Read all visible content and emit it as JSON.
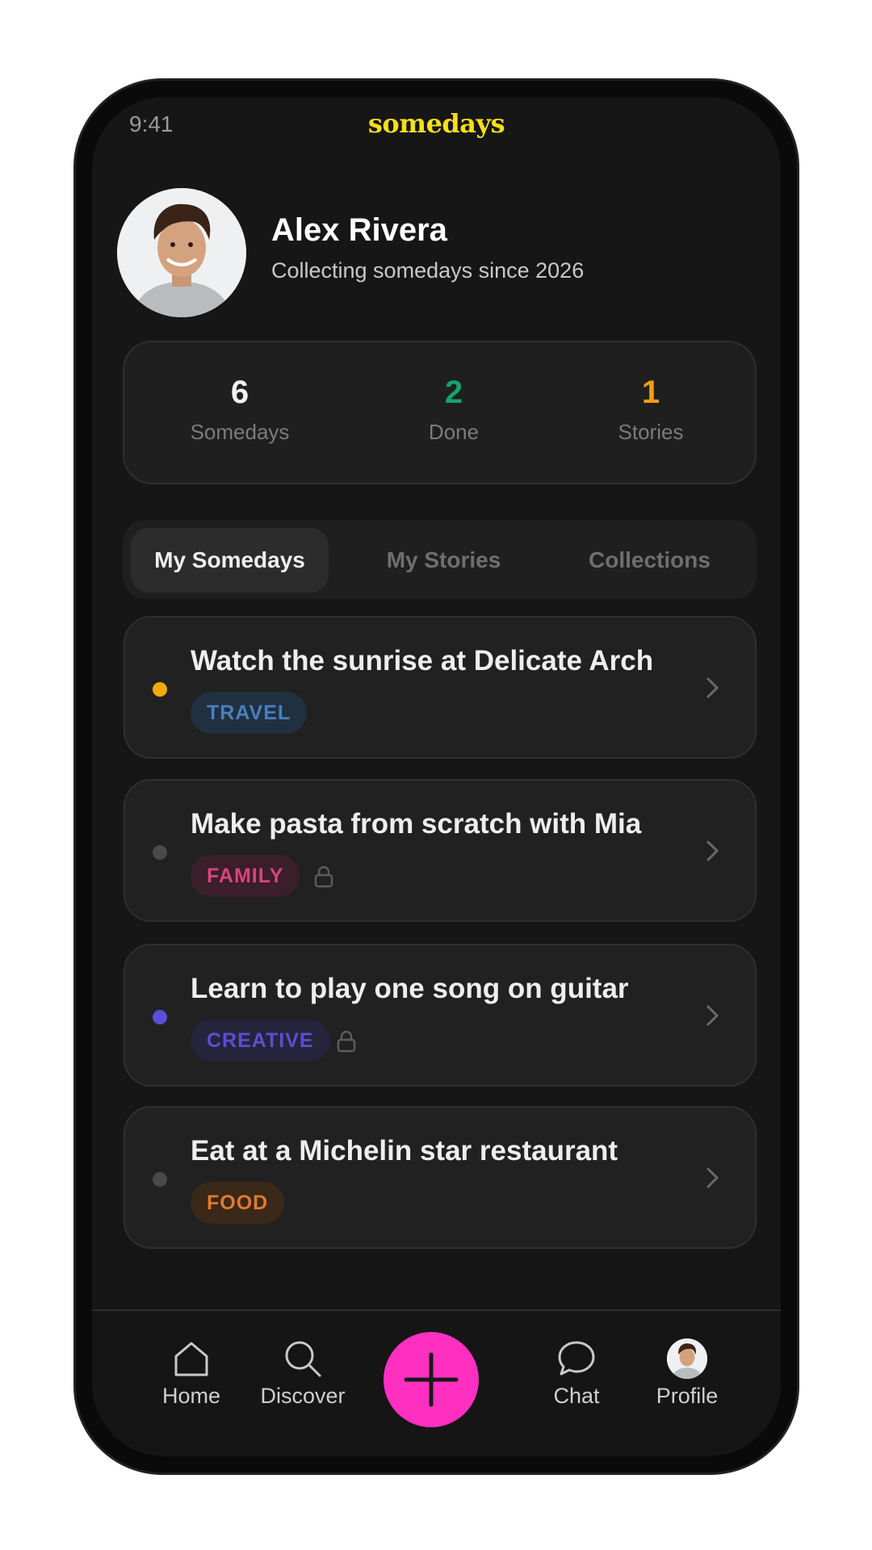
{
  "status": {
    "time": "9:41"
  },
  "app": {
    "brand": "somedays"
  },
  "profile": {
    "name": "Alex Rivera",
    "subtitle": "Collecting somedays since 2026"
  },
  "stats": [
    {
      "value": "6",
      "label": "Somedays",
      "color": "#f2f2f2"
    },
    {
      "value": "2",
      "label": "Done",
      "color": "#16a36b"
    },
    {
      "value": "1",
      "label": "Stories",
      "color": "#f29d12"
    }
  ],
  "tabs": [
    {
      "label": "My Somedays",
      "active": true
    },
    {
      "label": "My Stories",
      "active": false
    },
    {
      "label": "Collections",
      "active": false
    }
  ],
  "somedays": [
    {
      "title": "Watch the sunrise at Delicate Arch",
      "tag": "TRAVEL",
      "dot_color": "#f5a70f",
      "tag_color": "#4a7fc0",
      "tag_bg": "#203040",
      "locked": false
    },
    {
      "title": "Make pasta from scratch with Mia",
      "tag": "FAMILY",
      "dot_color": "#4a4a4a",
      "tag_color": "#d6457b",
      "tag_bg": "#3a1e2a",
      "locked": true
    },
    {
      "title": "Learn to play one song on guitar",
      "tag": "CREATIVE",
      "dot_color": "#5a4fd6",
      "tag_color": "#5b4fd1",
      "tag_bg": "#26243c",
      "locked": true
    },
    {
      "title": "Eat at a Michelin star restaurant",
      "tag": "FOOD",
      "dot_color": "#4a4a4a",
      "tag_color": "#e07a2e",
      "tag_bg": "#3a2818",
      "locked": false
    }
  ],
  "nav": {
    "home": "Home",
    "discover": "Discover",
    "chat": "Chat",
    "profile": "Profile",
    "add_color": "#ff2fc0"
  },
  "icons": [
    "lock-icon",
    "chevron-right-icon",
    "home-icon",
    "search-icon",
    "plus-icon",
    "chat-bubble-icon"
  ]
}
